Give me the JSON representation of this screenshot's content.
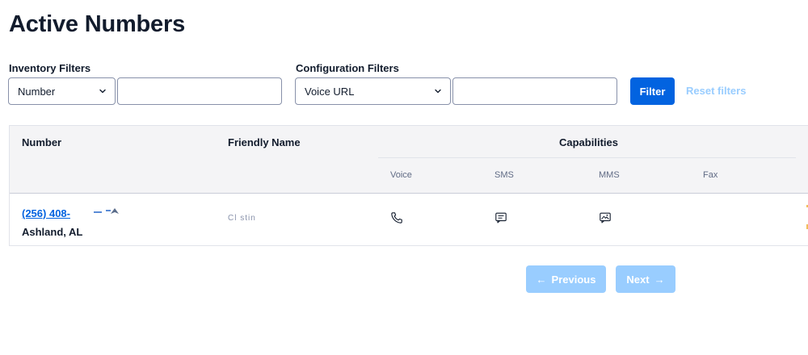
{
  "page": {
    "title": "Active Numbers"
  },
  "filters": {
    "inventory_label": "Inventory Filters",
    "inventory_select": "Number",
    "inventory_value": "",
    "configuration_label": "Configuration Filters",
    "configuration_select": "Voice URL",
    "configuration_value": "",
    "filter_button": "Filter",
    "reset_button": "Reset filters"
  },
  "table": {
    "headers": {
      "number": "Number",
      "friendly_name": "Friendly Name",
      "capabilities": "Capabilities"
    },
    "capability_columns": [
      "Voice",
      "SMS",
      "MMS",
      "Fax"
    ],
    "rows": [
      {
        "number": "(256) 408-",
        "location": "Ashland, AL",
        "friendly_name": "Cl   stin",
        "capabilities": {
          "voice": "phone-icon",
          "sms": "sms-icon",
          "mms": "mms-icon",
          "fax": ""
        }
      }
    ]
  },
  "pagination": {
    "previous": "Previous",
    "next": "Next"
  },
  "colors": {
    "primary": "#0263e0",
    "disabled_primary": "#99cdff",
    "text": "#121c2d",
    "muted": "#606b85",
    "header_bg": "#f4f4f6"
  }
}
